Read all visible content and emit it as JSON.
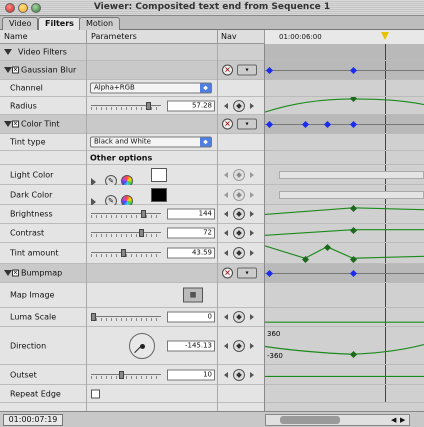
{
  "window": {
    "title": "Viewer: Composited text end from Sequence 1"
  },
  "tabs": [
    {
      "label": "Video"
    },
    {
      "label": "Filters"
    },
    {
      "label": "Motion"
    }
  ],
  "columns": {
    "name": "Name",
    "parameters": "Parameters",
    "nav": "Nav",
    "ruler_time": "01:00:06:00"
  },
  "rows": {
    "video_filters": "Video Filters",
    "gaussian_blur": "Gaussian Blur",
    "channel": {
      "label": "Channel",
      "value": "Alpha+RGB"
    },
    "radius": {
      "label": "Radius",
      "value": "57.28"
    },
    "color_tint": "Color Tint",
    "tint_type": {
      "label": "Tint type",
      "value": "Black and White"
    },
    "other_options": "Other options",
    "light_color": {
      "label": "Light Color"
    },
    "dark_color": {
      "label": "Dark Color"
    },
    "brightness": {
      "label": "Brightness",
      "value": "144"
    },
    "contrast": {
      "label": "Contrast",
      "value": "72"
    },
    "tint_amount": {
      "label": "Tint amount",
      "value": "43.59"
    },
    "bumpmap": "Bumpmap",
    "map_image": {
      "label": "Map Image"
    },
    "luma_scale": {
      "label": "Luma Scale",
      "value": "0"
    },
    "direction": {
      "label": "Direction",
      "value": "-145.13",
      "graph_max": "360",
      "graph_min": "-360"
    },
    "outset": {
      "label": "Outset",
      "value": "10"
    },
    "repeat_edge": {
      "label": "Repeat Edge"
    }
  },
  "status": {
    "timecode": "01:00:07:19"
  },
  "colors": {
    "light_color_swatch": "#ffffff",
    "dark_color_swatch": "#000000",
    "keyframe_blue": "#1a2cf0",
    "curve_green": "#1c8a1c"
  }
}
